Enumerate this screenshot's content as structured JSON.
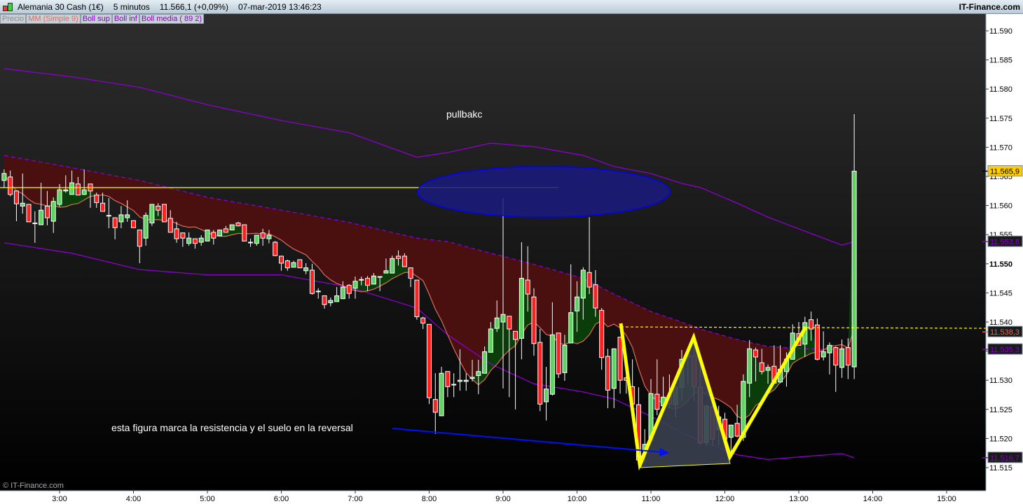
{
  "header": {
    "instrument": "Alemania 30 Cash (1€)",
    "interval": "5 minutos",
    "last_price": "11.566,1 (+0,09%)",
    "datetime": "07-mar-2019 13:46:23",
    "brand": "IT-Finance.com"
  },
  "legend": [
    {
      "label": "Precio",
      "color": "#8a8a8a"
    },
    {
      "label": "MM (Simple 9)",
      "color": "#e06a5a"
    },
    {
      "label": "Boll sup",
      "color": "#8a00cc"
    },
    {
      "label": "Boll inf",
      "color": "#8a00cc"
    },
    {
      "label": "Boll media ( 89 2)",
      "color": "#8a00cc"
    }
  ],
  "watermark": "© IT-Finance.com",
  "annotations": {
    "pullback_label": "pullbakc",
    "note_label": "esta figura marca la resistencia y el suelo en la reversal"
  },
  "colors": {
    "up": "#5fd35f",
    "down": "#ff2020",
    "ma": "#e06a5a",
    "bollinger": "#8a00cc",
    "red_fill": "#4a0f0f",
    "green_fill": "#0b3d0b",
    "zigzag": "#ffff00",
    "ellipse": "#1a1a80",
    "arrow": "#0010ff"
  },
  "chart_data": {
    "type": "candlestick",
    "interval": "5 minutos",
    "ylim": [
      11513,
      11593
    ],
    "y_ticks": [
      {
        "value": 11590,
        "label": "11.590"
      },
      {
        "value": 11585,
        "label": "11.585"
      },
      {
        "value": 11580,
        "label": "11.580"
      },
      {
        "value": 11575,
        "label": "11.575"
      },
      {
        "value": 11570,
        "label": "11.570"
      },
      {
        "value": 11565,
        "label": "11.565"
      },
      {
        "value": 11560,
        "label": "11.560"
      },
      {
        "value": 11555,
        "label": "11.555"
      },
      {
        "value": 11550,
        "label": "11.550",
        "bold": true
      },
      {
        "value": 11545,
        "label": "11.545"
      },
      {
        "value": 11540,
        "label": "11.540"
      },
      {
        "value": 11535,
        "label": "11.535"
      },
      {
        "value": 11530,
        "label": "11.530"
      },
      {
        "value": 11525,
        "label": "11.525"
      },
      {
        "value": 11520,
        "label": "11.520"
      },
      {
        "value": 11515,
        "label": "11.515"
      }
    ],
    "x_ticks": [
      "3:00",
      "4:00",
      "5:00",
      "6:00",
      "7:00",
      "8:00",
      "9:00",
      "10:00",
      "11:00",
      "12:00",
      "13:00",
      "14:00",
      "15:00"
    ],
    "candles_format": [
      "time",
      "open",
      "high",
      "low",
      "close"
    ],
    "candles": [
      [
        "2:15",
        11564.3,
        11566.2,
        11563.0,
        11565.5
      ],
      [
        "2:20",
        11564.9,
        11566.0,
        11561.6,
        11561.9
      ],
      [
        "2:25",
        11562.5,
        11562.5,
        11557.3,
        11560.3
      ],
      [
        "2:30",
        11559.9,
        11565.5,
        11558.6,
        11560.4
      ],
      [
        "2:35",
        11560.2,
        11560.2,
        11557.2,
        11557.2
      ],
      [
        "2:40",
        11557.0,
        11559.0,
        11553.6,
        11557.0
      ],
      [
        "2:45",
        11556.7,
        11563.9,
        11556.7,
        11559.2
      ],
      [
        "2:50",
        11559.9,
        11562.5,
        11556.6,
        11557.9
      ],
      [
        "2:55",
        11557.3,
        11561.4,
        11555.3,
        11560.7
      ],
      [
        "3:00",
        11560.2,
        11563.7,
        11559.8,
        11562.7
      ],
      [
        "3:05",
        11562.5,
        11565.2,
        11562.2,
        11562.7
      ],
      [
        "3:10",
        11561.9,
        11566.0,
        11561.9,
        11563.9
      ],
      [
        "3:15",
        11563.7,
        11564.9,
        11561.8,
        11561.8
      ],
      [
        "3:20",
        11561.9,
        11566.2,
        11561.8,
        11562.7
      ],
      [
        "3:25",
        11563.7,
        11563.7,
        11559.6,
        11562.5
      ],
      [
        "3:30",
        11561.8,
        11562.2,
        11559.6,
        11560.5
      ],
      [
        "3:35",
        11560.4,
        11562.2,
        11559.0,
        11559.0
      ],
      [
        "3:40",
        11558.3,
        11561.3,
        11556.1,
        11558.3
      ],
      [
        "3:45",
        11557.9,
        11557.9,
        11554.2,
        11556.2
      ],
      [
        "3:50",
        11557.2,
        11559.9,
        11556.1,
        11558.4
      ],
      [
        "3:55",
        11557.9,
        11560.9,
        11557.2,
        11558.4
      ],
      [
        "4:00",
        11557.4,
        11557.4,
        11556.2,
        11556.2
      ],
      [
        "4:05",
        11555.8,
        11555.8,
        11550.1,
        11553.0
      ],
      [
        "4:10",
        11554.4,
        11558.8,
        11553.1,
        11558.3
      ],
      [
        "4:15",
        11557.0,
        11560.2,
        11556.5,
        11560.2
      ],
      [
        "4:20",
        11559.9,
        11560.4,
        11558.2,
        11559.2
      ],
      [
        "4:25",
        11560.2,
        11560.2,
        11557.2,
        11557.2
      ],
      [
        "4:30",
        11557.8,
        11559.2,
        11555.4,
        11555.4
      ],
      [
        "4:35",
        11556.0,
        11557.2,
        11553.6,
        11554.3
      ],
      [
        "4:40",
        11555.3,
        11555.3,
        11552.9,
        11554.4
      ],
      [
        "4:45",
        11553.5,
        11555.4,
        11553.1,
        11554.4
      ],
      [
        "4:50",
        11554.3,
        11554.3,
        11552.6,
        11553.5
      ],
      [
        "4:55",
        11553.7,
        11554.9,
        11553.1,
        11554.4
      ],
      [
        "5:00",
        11553.9,
        11555.8,
        11553.9,
        11555.8
      ],
      [
        "5:05",
        11555.4,
        11555.8,
        11553.3,
        11554.4
      ],
      [
        "5:10",
        11554.8,
        11555.8,
        11554.8,
        11555.8
      ],
      [
        "5:15",
        11556.0,
        11556.5,
        11555.4,
        11555.4
      ],
      [
        "5:20",
        11555.8,
        11556.7,
        11555.8,
        11556.7
      ],
      [
        "5:25",
        11557.0,
        11557.2,
        11556.5,
        11556.5
      ],
      [
        "5:30",
        11556.7,
        11556.7,
        11553.9,
        11553.9
      ],
      [
        "5:35",
        11553.7,
        11554.3,
        11552.9,
        11553.7
      ],
      [
        "5:40",
        11553.5,
        11554.9,
        11553.1,
        11554.9
      ],
      [
        "5:45",
        11555.3,
        11556.0,
        11553.1,
        11554.4
      ],
      [
        "5:50",
        11554.3,
        11555.8,
        11553.5,
        11554.9
      ],
      [
        "5:55",
        11553.7,
        11553.9,
        11551.4,
        11551.4
      ],
      [
        "6:00",
        11551.3,
        11551.4,
        11548.8,
        11550.1
      ],
      [
        "6:05",
        11550.5,
        11550.7,
        11548.8,
        11549.3
      ],
      [
        "6:10",
        11549.4,
        11550.5,
        11549.4,
        11550.2
      ],
      [
        "6:15",
        11550.7,
        11550.7,
        11549.3,
        11549.3
      ],
      [
        "6:20",
        11548.8,
        11550.1,
        11548.2,
        11549.3
      ],
      [
        "6:25",
        11548.9,
        11550.0,
        11544.7,
        11544.9
      ],
      [
        "6:30",
        11545.3,
        11545.8,
        11544.0,
        11545.3
      ],
      [
        "6:35",
        11544.5,
        11544.5,
        11542.3,
        11543.0
      ],
      [
        "6:40",
        11543.3,
        11544.2,
        11542.7,
        11543.7
      ],
      [
        "6:45",
        11543.5,
        11546.0,
        11543.5,
        11544.5
      ],
      [
        "6:50",
        11544.0,
        11547.0,
        11544.0,
        11546.0
      ],
      [
        "6:55",
        11546.3,
        11546.5,
        11544.0,
        11544.9
      ],
      [
        "7:00",
        11545.8,
        11547.8,
        11544.0,
        11547.0
      ],
      [
        "7:05",
        11547.3,
        11547.8,
        11546.3,
        11547.3
      ],
      [
        "7:10",
        11547.5,
        11547.9,
        11545.3,
        11546.3
      ],
      [
        "7:15",
        11546.5,
        11548.4,
        11546.5,
        11547.9
      ],
      [
        "7:20",
        11547.8,
        11547.8,
        11545.3,
        11547.8
      ],
      [
        "7:25",
        11548.4,
        11550.9,
        11548.4,
        11548.8
      ],
      [
        "7:30",
        11548.4,
        11551.4,
        11548.4,
        11550.9
      ],
      [
        "7:35",
        11551.3,
        11552.3,
        11549.7,
        11550.9
      ],
      [
        "7:40",
        11551.3,
        11551.8,
        11549.5,
        11549.5
      ],
      [
        "7:45",
        11549.3,
        11549.3,
        11546.0,
        11547.5
      ],
      [
        "7:50",
        11547.2,
        11547.2,
        11540.4,
        11540.9
      ],
      [
        "7:55",
        11540.7,
        11540.9,
        11538.8,
        11539.8
      ],
      [
        "8:00",
        11539.6,
        11539.6,
        11525.9,
        11527.0
      ],
      [
        "8:05",
        11526.7,
        11531.2,
        11520.8,
        11524.5
      ],
      [
        "8:10",
        11523.9,
        11532.3,
        11523.9,
        11531.2
      ],
      [
        "8:15",
        11531.5,
        11531.5,
        11527.1,
        11528.9
      ],
      [
        "8:20",
        11529.3,
        11531.2,
        11527.1,
        11529.3
      ],
      [
        "8:25",
        11529.8,
        11535.3,
        11528.2,
        11530.0
      ],
      [
        "8:30",
        11529.8,
        11531.2,
        11528.2,
        11530.0
      ],
      [
        "8:35",
        11530.3,
        11533.5,
        11529.8,
        11530.5
      ],
      [
        "8:40",
        11530.8,
        11533.5,
        11527.6,
        11531.5
      ],
      [
        "8:45",
        11531.2,
        11535.8,
        11531.2,
        11534.9
      ],
      [
        "8:50",
        11534.8,
        11540.0,
        11534.8,
        11538.8
      ],
      [
        "8:55",
        11538.9,
        11543.7,
        11538.3,
        11540.7
      ],
      [
        "9:00",
        11540.0,
        11561.3,
        11528.6,
        11541.3
      ],
      [
        "9:05",
        11541.0,
        11541.0,
        11527.1,
        11538.8
      ],
      [
        "9:10",
        11538.4,
        11538.4,
        11525.0,
        11537.0
      ],
      [
        "9:15",
        11537.2,
        11553.7,
        11533.6,
        11547.5
      ],
      [
        "9:20",
        11547.2,
        11553.0,
        11541.8,
        11544.8
      ],
      [
        "9:25",
        11544.3,
        11545.8,
        11534.2,
        11536.3
      ],
      [
        "9:30",
        11536.5,
        11538.8,
        11524.7,
        11525.9
      ],
      [
        "9:35",
        11526.3,
        11532.3,
        11523.1,
        11528.5
      ],
      [
        "9:40",
        11527.6,
        11543.4,
        11527.4,
        11537.8
      ],
      [
        "9:45",
        11538.1,
        11538.1,
        11530.4,
        11531.1
      ],
      [
        "9:50",
        11531.3,
        11537.8,
        11529.9,
        11536.0
      ],
      [
        "9:55",
        11536.4,
        11549.9,
        11536.4,
        11541.6
      ],
      [
        "10:00",
        11541.9,
        11547.0,
        11538.3,
        11544.3
      ],
      [
        "10:05",
        11544.1,
        11549.4,
        11540.4,
        11548.9
      ],
      [
        "10:10",
        11548.5,
        11558.0,
        11544.8,
        11546.0
      ],
      [
        "10:15",
        11546.4,
        11548.9,
        11540.9,
        11542.4
      ],
      [
        "10:20",
        11542.0,
        11542.4,
        11531.8,
        11533.9
      ],
      [
        "10:25",
        11534.1,
        11535.4,
        11525.2,
        11528.3
      ],
      [
        "10:30",
        11528.6,
        11535.4,
        11525.2,
        11535.4
      ],
      [
        "10:35",
        11537.4,
        11537.4,
        11527.7,
        11530.0
      ],
      [
        "10:40",
        11530.4,
        11533.6,
        11527.7,
        11530.0
      ],
      [
        "10:45",
        11528.9,
        11533.6,
        11525.9,
        11525.9
      ],
      [
        "10:50",
        11525.8,
        11528.8,
        11516.0,
        11516.3
      ],
      [
        "10:55",
        11518.0,
        11521.6,
        11516.0,
        11519.0
      ],
      [
        "11:00",
        11519.6,
        11530.2,
        11519.6,
        11527.7
      ],
      [
        "11:05",
        11527.6,
        11533.6,
        11524.0,
        11525.0
      ],
      [
        "11:10",
        11525.6,
        11530.6,
        11525.6,
        11527.1
      ],
      [
        "11:15",
        11527.3,
        11531.0,
        11525.2,
        11525.9
      ],
      [
        "11:20",
        11525.8,
        11528.9,
        11523.6,
        11528.9
      ],
      [
        "11:25",
        11528.8,
        11535.2,
        11526.5,
        11533.6
      ],
      [
        "11:30",
        11534.0,
        11534.5,
        11529.2,
        11534.5
      ],
      [
        "11:35",
        11534.2,
        11537.2,
        11526.4,
        11528.9
      ],
      [
        "11:40",
        11528.8,
        11533.2,
        11519.0,
        11519.2
      ],
      [
        "11:45",
        11519.3,
        11525.6,
        11518.7,
        11525.6
      ],
      [
        "11:50",
        11525.4,
        11526.5,
        11518.7,
        11519.9
      ],
      [
        "11:55",
        11521.5,
        11525.6,
        11518.7,
        11523.7
      ],
      [
        "12:00",
        11523.3,
        11524.4,
        11518.7,
        11519.9
      ],
      [
        "12:05",
        11520.2,
        11522.3,
        11517.2,
        11522.3
      ],
      [
        "12:10",
        11522.6,
        11525.8,
        11520.2,
        11520.4
      ],
      [
        "12:15",
        11520.2,
        11531.0,
        11519.6,
        11529.8
      ],
      [
        "12:20",
        11529.5,
        11536.9,
        11527.1,
        11535.4
      ],
      [
        "12:25",
        11535.2,
        11535.6,
        11529.8,
        11534.0
      ],
      [
        "12:30",
        11533.0,
        11535.4,
        11531.0,
        11531.5
      ],
      [
        "12:35",
        11531.7,
        11532.7,
        11529.4,
        11532.2
      ],
      [
        "12:40",
        11532.4,
        11536.0,
        11529.5,
        11529.5
      ],
      [
        "12:45",
        11529.7,
        11536.0,
        11529.5,
        11531.9
      ],
      [
        "12:50",
        11531.5,
        11534.8,
        11528.9,
        11533.6
      ],
      [
        "12:55",
        11533.6,
        11539.6,
        11533.6,
        11538.1
      ],
      [
        "13:00",
        11538.0,
        11540.0,
        11536.0,
        11536.0
      ],
      [
        "13:05",
        11536.2,
        11540.9,
        11534.0,
        11539.9
      ],
      [
        "13:10",
        11540.4,
        11541.8,
        11536.8,
        11538.8
      ],
      [
        "13:15",
        11539.5,
        11540.6,
        11533.4,
        11533.6
      ],
      [
        "13:20",
        11534.0,
        11538.4,
        11533.4,
        11534.9
      ],
      [
        "13:25",
        11534.7,
        11536.5,
        11531.0,
        11536.0
      ],
      [
        "13:30",
        11535.6,
        11535.8,
        11528.0,
        11532.6
      ],
      [
        "13:35",
        11532.2,
        11537.0,
        11530.4,
        11535.4
      ],
      [
        "13:40",
        11535.6,
        11537.2,
        11530.2,
        11532.6
      ],
      [
        "13:45",
        11532.3,
        11575.7,
        11530.2,
        11565.9
      ]
    ],
    "bollinger": {
      "period": 89,
      "deviations": 2,
      "times": [
        "2:15",
        "3:10",
        "4:05",
        "5:00",
        "6:00",
        "6:55",
        "7:50",
        "8:15",
        "8:50",
        "9:25",
        "10:05",
        "10:30",
        "11:00",
        "11:25",
        "11:40",
        "12:10",
        "12:35",
        "13:05",
        "13:35",
        "13:45"
      ],
      "upper": [
        11583.5,
        11582.1,
        11580.3,
        11577.3,
        11574.6,
        11572.5,
        11568.3,
        11569.1,
        11570.7,
        11570.1,
        11568.6,
        11566.7,
        11565.5,
        11563.8,
        11563.1,
        11560.4,
        11558.0,
        11555.6,
        11553.2,
        11553.8
      ],
      "middle": [
        11568.6,
        11566.5,
        11564.3,
        11561.4,
        11559.2,
        11557.1,
        11554.4,
        11553.8,
        11551.8,
        11549.9,
        11547.5,
        11544.8,
        11541.8,
        11540.0,
        11538.8,
        11537.0,
        11535.8,
        11535.4,
        11535.2,
        11535.3
      ],
      "lower": [
        11553.6,
        11551.8,
        11549.0,
        11548.1,
        11548.1,
        11546.0,
        11542.4,
        11537.8,
        11532.8,
        11529.4,
        11528.0,
        11526.8,
        11523.8,
        11521.0,
        11519.6,
        11517.2,
        11516.4,
        11516.9,
        11517.4,
        11516.7
      ]
    },
    "moving_average": {
      "type": "simple",
      "period": 9
    },
    "price_labels": [
      {
        "series": "Precio",
        "value": 11565.9,
        "text": "11.565,9",
        "bg": "#ffcc00",
        "fg": "#000000"
      },
      {
        "series": "Boll sup",
        "value": 11553.8,
        "text": "11.553,8",
        "bg": "#1a1a1a",
        "fg": "#8a00cc"
      },
      {
        "series": "MM (Simple 9)",
        "value": 11538.3,
        "text": "11.538,3",
        "bg": "#1a1a1a",
        "fg": "#e06a5a"
      },
      {
        "series": "Boll media",
        "value": 11535.3,
        "text": "11.535,3",
        "bg": "#1a1a1a",
        "fg": "#8a00cc"
      },
      {
        "series": "Boll inf",
        "value": 11516.7,
        "text": "11.516,7",
        "bg": "#1a1a1a",
        "fg": "#8a00cc"
      }
    ]
  }
}
